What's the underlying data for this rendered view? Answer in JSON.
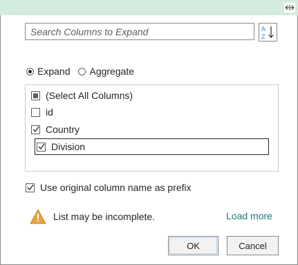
{
  "header": {
    "expand_icon": "expand-arrows-icon"
  },
  "search": {
    "placeholder": "Search Columns to Expand",
    "value": "",
    "sort_icon": "sort-az-icon"
  },
  "mode": {
    "options": [
      {
        "label": "Expand",
        "selected": true
      },
      {
        "label": "Aggregate",
        "selected": false
      }
    ]
  },
  "columns": {
    "items": [
      {
        "label": "(Select All Columns)",
        "state": "partial"
      },
      {
        "label": "id",
        "state": "unchecked"
      },
      {
        "label": "Country",
        "state": "checked"
      },
      {
        "label": "Division",
        "state": "checked",
        "focused": true
      }
    ]
  },
  "prefix": {
    "label": "Use original column name as prefix",
    "checked": true
  },
  "warning": {
    "text": "List may be incomplete.",
    "icon": "warning-icon",
    "icon_color": "#e8a33d"
  },
  "load_more": {
    "label": "Load more",
    "color": "#1a7a7a"
  },
  "buttons": {
    "ok": "OK",
    "cancel": "Cancel"
  }
}
